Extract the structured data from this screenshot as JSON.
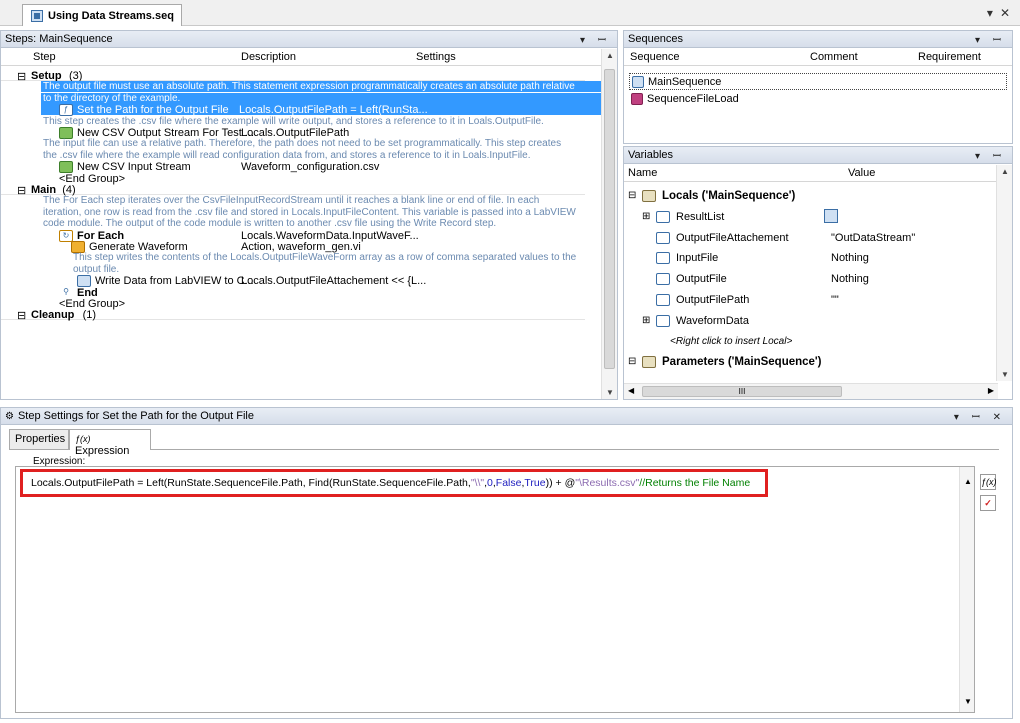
{
  "document_tab": {
    "title": "Using Data Streams.seq"
  },
  "window_controls": {
    "dropdown": "▾",
    "close": "✕"
  },
  "steps_pane": {
    "title": "Steps: MainSequence",
    "columns": [
      "Step",
      "Description",
      "Settings"
    ],
    "rows": [
      {
        "kind": "group",
        "indent": 16,
        "expander": "⊟",
        "label": "Setup",
        "count": "(3)"
      },
      {
        "kind": "comment-sel",
        "indent": 42,
        "text": "The output file must use an absolute path. This statement expression programmatically creates an absolute path relative"
      },
      {
        "kind": "comment-sel",
        "indent": 42,
        "text": "to the directory of the example."
      },
      {
        "kind": "step-sel",
        "indent": 58,
        "icon": "fx-icon",
        "label": "Set the Path for the Output File",
        "desc": "Locals.OutputFilePath = Left(RunSta..."
      },
      {
        "kind": "comment",
        "indent": 58,
        "text": "This step creates the .csv file where the example will write output, and stores a reference to it in Loals.OutputFile."
      },
      {
        "kind": "step",
        "indent": 58,
        "icon": "stream-icon",
        "label": "New CSV Output Stream For Test ...",
        "desc": "Locals.OutputFilePath"
      },
      {
        "kind": "comment",
        "indent": 58,
        "text": "The input file can use a relative path. Therefore, the path does not need to be set programmatically. This step creates"
      },
      {
        "kind": "comment",
        "indent": 58,
        "text": "the .csv file where the example will read configuration data from, and stores a reference to it in Loals.InputFile."
      },
      {
        "kind": "step",
        "indent": 58,
        "icon": "stream-icon",
        "label": "New CSV Input Stream",
        "desc": "Waveform_configuration.csv"
      },
      {
        "kind": "plain",
        "indent": 58,
        "text": "<End Group>"
      },
      {
        "kind": "group",
        "indent": 16,
        "expander": "⊟",
        "label": "Main",
        "count": "(4)"
      },
      {
        "kind": "comment",
        "indent": 58,
        "text": "The For Each step iterates over the CsvFileInputRecordStream until it reaches a blank line or end of file. In each"
      },
      {
        "kind": "comment",
        "indent": 58,
        "text": "iteration, one row is read from the .csv file and stored in Locals.InputFileContent.  This variable is passed into a LabVIEW"
      },
      {
        "kind": "comment",
        "indent": 58,
        "text": "code module. The output of the code module is written to another .csv file using the Write Record step."
      },
      {
        "kind": "step-bold",
        "indent": 58,
        "icon": "loop-icon",
        "label": "For Each",
        "desc": "Locals.WaveformData.InputWaveF..."
      },
      {
        "kind": "step",
        "indent": 70,
        "icon": "labview-icon",
        "label": "Generate Waveform",
        "desc": "Action,  waveform_gen.vi"
      },
      {
        "kind": "comment",
        "indent": 88,
        "text": "This step writes the contents of the Locals.OutputFileWaveForm array as a row of comma separated values to the"
      },
      {
        "kind": "comment",
        "indent": 88,
        "text": "output file."
      },
      {
        "kind": "step",
        "indent": 76,
        "icon": "write-icon",
        "label": "Write Data from LabVIEW to C...",
        "desc": "Locals.OutputFileAttachement << {L..."
      },
      {
        "kind": "step-bold",
        "indent": 58,
        "icon": "end-icon",
        "label": "End",
        "desc": ""
      },
      {
        "kind": "plain",
        "indent": 58,
        "text": "<End Group>"
      },
      {
        "kind": "group",
        "indent": 16,
        "expander": "⊟",
        "label": "Cleanup",
        "count": "(1)"
      }
    ]
  },
  "sequences_pane": {
    "title": "Sequences",
    "columns": [
      "Sequence",
      "Comment",
      "Requirement"
    ],
    "items": [
      "MainSequence",
      "SequenceFileLoad"
    ]
  },
  "variables_pane": {
    "title": "Variables",
    "columns": [
      "Name",
      "Value"
    ],
    "rows": [
      {
        "level": 0,
        "expander": "⊟",
        "icon": "locals-icon",
        "name": "Locals ('MainSequence')",
        "value": "",
        "bold": true
      },
      {
        "level": 1,
        "expander": "⊞",
        "icon": "array-icon",
        "name": "ResultList",
        "value": "",
        "extra": "table-button"
      },
      {
        "level": 1,
        "expander": "",
        "icon": "string-icon",
        "name": "OutputFileAttachement",
        "value": "\"OutDataStream\""
      },
      {
        "level": 1,
        "expander": "",
        "icon": "ref-icon",
        "name": "InputFile",
        "value": "Nothing"
      },
      {
        "level": 1,
        "expander": "",
        "icon": "ref-icon",
        "name": "OutputFile",
        "value": "Nothing"
      },
      {
        "level": 1,
        "expander": "",
        "icon": "string-icon",
        "name": "OutputFilePath",
        "value": "\"\""
      },
      {
        "level": 1,
        "expander": "⊞",
        "icon": "container-icon",
        "name": "WaveformData",
        "value": ""
      },
      {
        "level": 1,
        "expander": "",
        "icon": "",
        "name": "<Right click to insert Local>",
        "value": "",
        "italic": true
      },
      {
        "level": 0,
        "expander": "⊟",
        "icon": "params-icon",
        "name": "Parameters ('MainSequence')",
        "value": "",
        "bold": true
      }
    ],
    "hscroll_label": "III"
  },
  "settings_pane": {
    "title": "Step Settings for Set the Path for the Output File",
    "tabs": [
      "Properties",
      "Expression"
    ],
    "active_tab": "Expression",
    "expression_label": "Expression:",
    "expr": {
      "p1": "Locals.OutputFilePath = Left(RunState.SequenceFile.Path, Find(RunState.SequenceFile.Path, ",
      "s1": "\"\\\\\"",
      "p2": ", ",
      "n1": "0",
      "p3": ", ",
      "k1": "False",
      "p4": ", ",
      "k2": "True",
      "p5": "))  + @",
      "s2": "\"\\Results.csv\"",
      "c1": " //Returns the File Name"
    },
    "side_buttons": [
      "fx-button",
      "check-button"
    ]
  },
  "colors": {
    "selection": "#3399ff",
    "comment": "#6b8ab0",
    "string": "#8b6ab0",
    "keyword": "#2020c0",
    "comment_code": "#008000",
    "highlight_box": "#e02020"
  }
}
